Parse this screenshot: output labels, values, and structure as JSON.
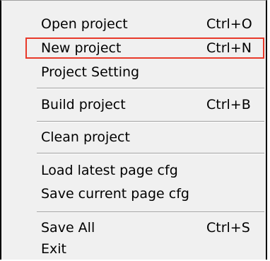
{
  "menu": {
    "items": [
      {
        "label": "Open project",
        "shortcut": "Ctrl+O"
      },
      {
        "label": "New project",
        "shortcut": "Ctrl+N"
      },
      {
        "label": "Project Setting",
        "shortcut": ""
      },
      {
        "label": "Build project",
        "shortcut": "Ctrl+B"
      },
      {
        "label": "Clean project",
        "shortcut": ""
      },
      {
        "label": "Load latest page cfg",
        "shortcut": ""
      },
      {
        "label": "Save current page cfg",
        "shortcut": ""
      },
      {
        "label": "Save All",
        "shortcut": "Ctrl+S"
      },
      {
        "label": "Exit",
        "shortcut": ""
      }
    ],
    "highlight_color": "#e8392a"
  }
}
